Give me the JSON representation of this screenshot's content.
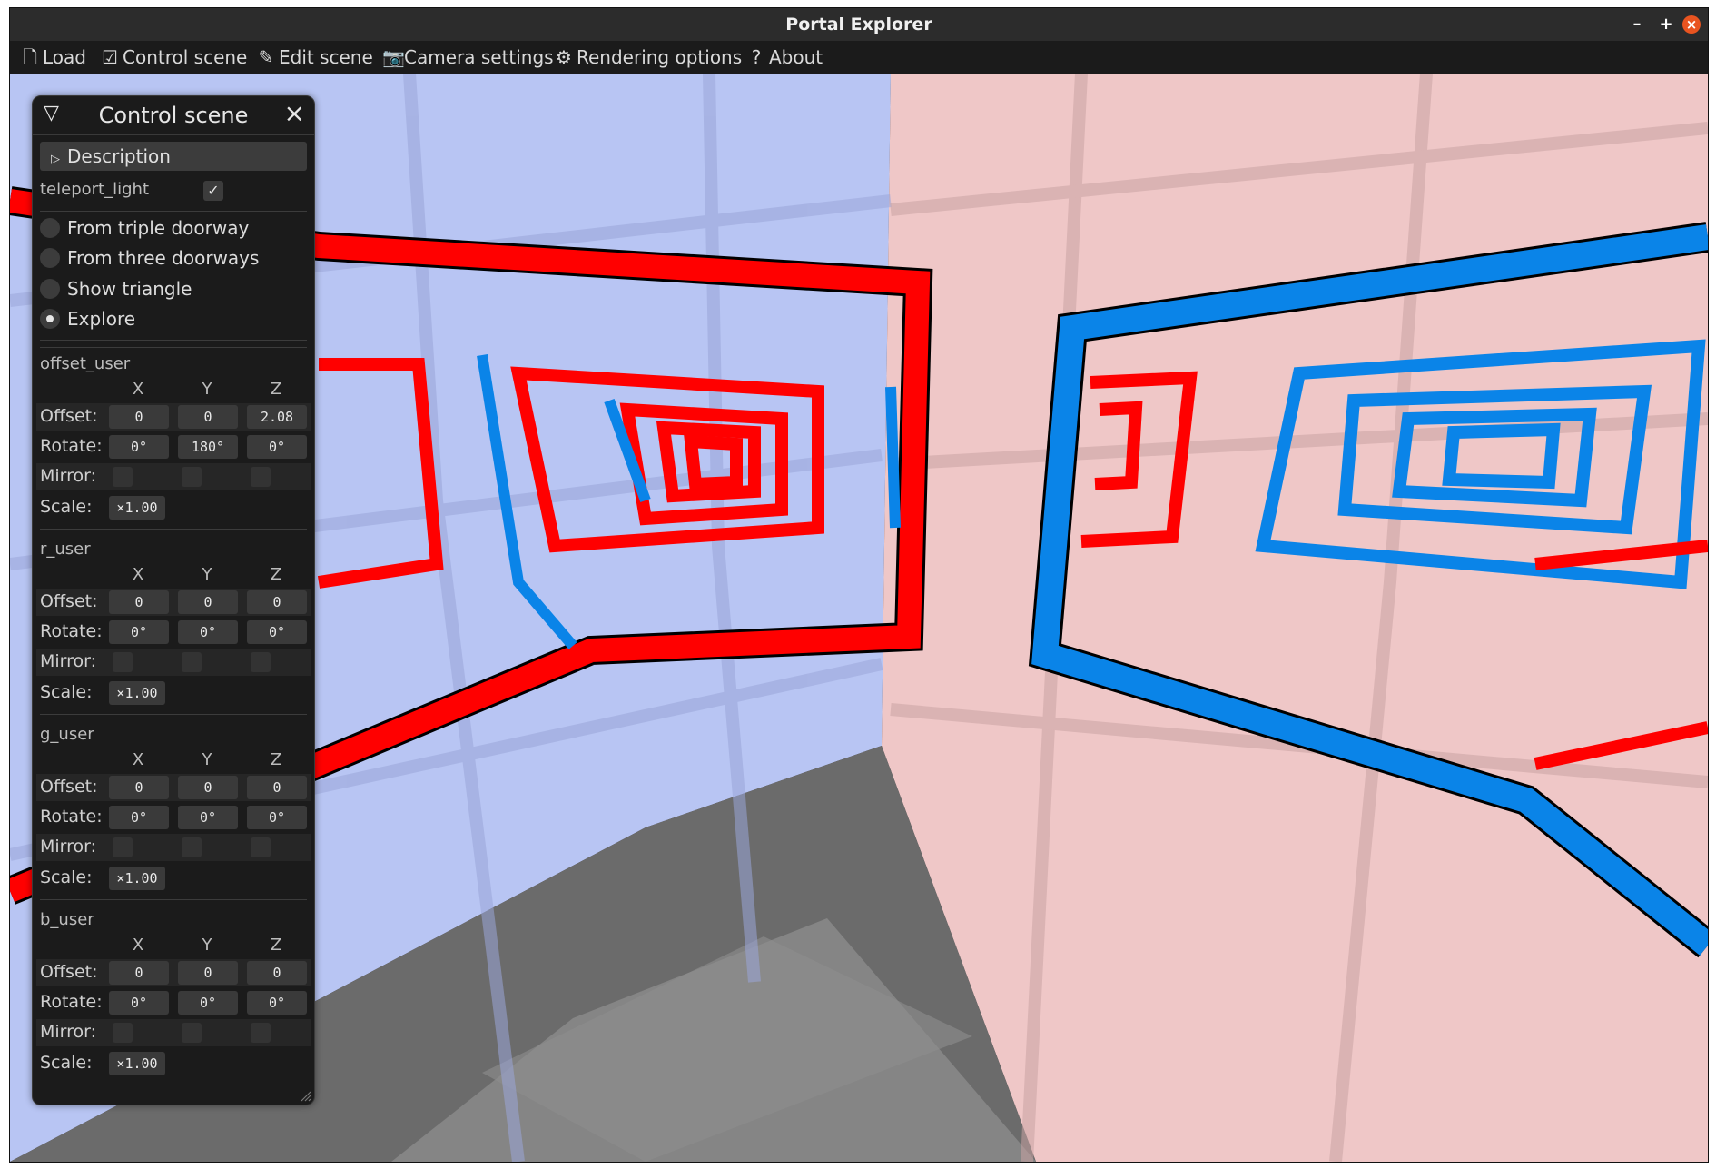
{
  "window": {
    "title": "Portal Explorer",
    "minimize": "–",
    "maximize": "+",
    "close": "×"
  },
  "menu": [
    {
      "label": "Load",
      "icon": "file-icon"
    },
    {
      "label": "Control scene",
      "icon": "checkbox-icon"
    },
    {
      "label": "Edit scene",
      "icon": "pencil-icon"
    },
    {
      "label": "Camera settings",
      "icon": "camera-icon"
    },
    {
      "label": "Rendering options",
      "icon": "gear-icon"
    },
    {
      "label": "About",
      "icon": "question-icon"
    }
  ],
  "panel": {
    "title": "Control scene",
    "description": "Description",
    "teleport_light": {
      "label": "teleport_light",
      "checked": true
    },
    "scenes": [
      {
        "label": "From triple doorway",
        "selected": false
      },
      {
        "label": "From three doorways",
        "selected": false
      },
      {
        "label": "Show triangle",
        "selected": false
      },
      {
        "label": "Explore",
        "selected": true
      }
    ],
    "axes": [
      "X",
      "Y",
      "Z"
    ],
    "row_labels": {
      "offset": "Offset:",
      "rotate": "Rotate:",
      "mirror": "Mirror:",
      "scale": "Scale:"
    },
    "groups": [
      {
        "name": "offset_user",
        "offset": [
          "0",
          "0",
          "2.08"
        ],
        "rotate": [
          "0°",
          "180°",
          "0°"
        ],
        "scale": "×1.00"
      },
      {
        "name": "r_user",
        "offset": [
          "0",
          "0",
          "0"
        ],
        "rotate": [
          "0°",
          "0°",
          "0°"
        ],
        "scale": "×1.00"
      },
      {
        "name": "g_user",
        "offset": [
          "0",
          "0",
          "0"
        ],
        "rotate": [
          "0°",
          "0°",
          "0°"
        ],
        "scale": "×1.00"
      },
      {
        "name": "b_user",
        "offset": [
          "0",
          "0",
          "0"
        ],
        "rotate": [
          "0°",
          "0°",
          "0°"
        ],
        "scale": "×1.00"
      }
    ]
  },
  "colors": {
    "portal_red": "#ff0000",
    "portal_blue": "#0a84e8",
    "wall_blue": "#b5c2f4",
    "wall_pink": "#eec4c4",
    "floor": "#6e6e6e",
    "close_button": "#e95420"
  }
}
